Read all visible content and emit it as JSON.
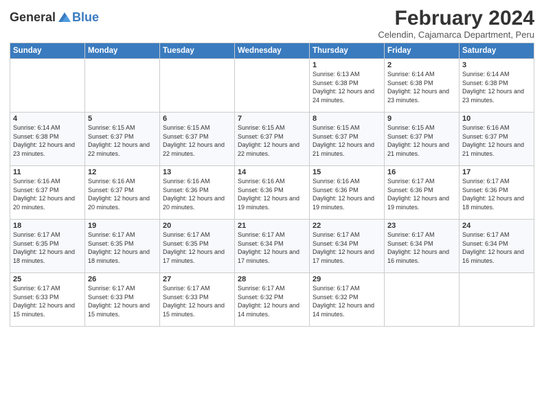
{
  "header": {
    "logo_general": "General",
    "logo_blue": "Blue",
    "title": "February 2024",
    "subtitle": "Celendin, Cajamarca Department, Peru"
  },
  "days_of_week": [
    "Sunday",
    "Monday",
    "Tuesday",
    "Wednesday",
    "Thursday",
    "Friday",
    "Saturday"
  ],
  "weeks": [
    [
      {
        "day": "",
        "info": ""
      },
      {
        "day": "",
        "info": ""
      },
      {
        "day": "",
        "info": ""
      },
      {
        "day": "",
        "info": ""
      },
      {
        "day": "1",
        "info": "Sunrise: 6:13 AM\nSunset: 6:38 PM\nDaylight: 12 hours and 24 minutes."
      },
      {
        "day": "2",
        "info": "Sunrise: 6:14 AM\nSunset: 6:38 PM\nDaylight: 12 hours and 23 minutes."
      },
      {
        "day": "3",
        "info": "Sunrise: 6:14 AM\nSunset: 6:38 PM\nDaylight: 12 hours and 23 minutes."
      }
    ],
    [
      {
        "day": "4",
        "info": "Sunrise: 6:14 AM\nSunset: 6:38 PM\nDaylight: 12 hours and 23 minutes."
      },
      {
        "day": "5",
        "info": "Sunrise: 6:15 AM\nSunset: 6:37 PM\nDaylight: 12 hours and 22 minutes."
      },
      {
        "day": "6",
        "info": "Sunrise: 6:15 AM\nSunset: 6:37 PM\nDaylight: 12 hours and 22 minutes."
      },
      {
        "day": "7",
        "info": "Sunrise: 6:15 AM\nSunset: 6:37 PM\nDaylight: 12 hours and 22 minutes."
      },
      {
        "day": "8",
        "info": "Sunrise: 6:15 AM\nSunset: 6:37 PM\nDaylight: 12 hours and 21 minutes."
      },
      {
        "day": "9",
        "info": "Sunrise: 6:15 AM\nSunset: 6:37 PM\nDaylight: 12 hours and 21 minutes."
      },
      {
        "day": "10",
        "info": "Sunrise: 6:16 AM\nSunset: 6:37 PM\nDaylight: 12 hours and 21 minutes."
      }
    ],
    [
      {
        "day": "11",
        "info": "Sunrise: 6:16 AM\nSunset: 6:37 PM\nDaylight: 12 hours and 20 minutes."
      },
      {
        "day": "12",
        "info": "Sunrise: 6:16 AM\nSunset: 6:37 PM\nDaylight: 12 hours and 20 minutes."
      },
      {
        "day": "13",
        "info": "Sunrise: 6:16 AM\nSunset: 6:36 PM\nDaylight: 12 hours and 20 minutes."
      },
      {
        "day": "14",
        "info": "Sunrise: 6:16 AM\nSunset: 6:36 PM\nDaylight: 12 hours and 19 minutes."
      },
      {
        "day": "15",
        "info": "Sunrise: 6:16 AM\nSunset: 6:36 PM\nDaylight: 12 hours and 19 minutes."
      },
      {
        "day": "16",
        "info": "Sunrise: 6:17 AM\nSunset: 6:36 PM\nDaylight: 12 hours and 19 minutes."
      },
      {
        "day": "17",
        "info": "Sunrise: 6:17 AM\nSunset: 6:36 PM\nDaylight: 12 hours and 18 minutes."
      }
    ],
    [
      {
        "day": "18",
        "info": "Sunrise: 6:17 AM\nSunset: 6:35 PM\nDaylight: 12 hours and 18 minutes."
      },
      {
        "day": "19",
        "info": "Sunrise: 6:17 AM\nSunset: 6:35 PM\nDaylight: 12 hours and 18 minutes."
      },
      {
        "day": "20",
        "info": "Sunrise: 6:17 AM\nSunset: 6:35 PM\nDaylight: 12 hours and 17 minutes."
      },
      {
        "day": "21",
        "info": "Sunrise: 6:17 AM\nSunset: 6:34 PM\nDaylight: 12 hours and 17 minutes."
      },
      {
        "day": "22",
        "info": "Sunrise: 6:17 AM\nSunset: 6:34 PM\nDaylight: 12 hours and 17 minutes."
      },
      {
        "day": "23",
        "info": "Sunrise: 6:17 AM\nSunset: 6:34 PM\nDaylight: 12 hours and 16 minutes."
      },
      {
        "day": "24",
        "info": "Sunrise: 6:17 AM\nSunset: 6:34 PM\nDaylight: 12 hours and 16 minutes."
      }
    ],
    [
      {
        "day": "25",
        "info": "Sunrise: 6:17 AM\nSunset: 6:33 PM\nDaylight: 12 hours and 15 minutes."
      },
      {
        "day": "26",
        "info": "Sunrise: 6:17 AM\nSunset: 6:33 PM\nDaylight: 12 hours and 15 minutes."
      },
      {
        "day": "27",
        "info": "Sunrise: 6:17 AM\nSunset: 6:33 PM\nDaylight: 12 hours and 15 minutes."
      },
      {
        "day": "28",
        "info": "Sunrise: 6:17 AM\nSunset: 6:32 PM\nDaylight: 12 hours and 14 minutes."
      },
      {
        "day": "29",
        "info": "Sunrise: 6:17 AM\nSunset: 6:32 PM\nDaylight: 12 hours and 14 minutes."
      },
      {
        "day": "",
        "info": ""
      },
      {
        "day": "",
        "info": ""
      }
    ]
  ]
}
